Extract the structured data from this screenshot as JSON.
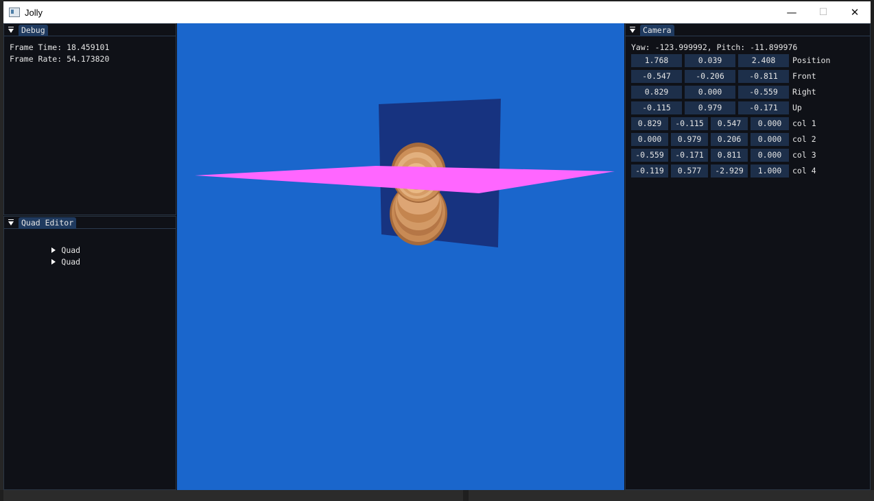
{
  "window": {
    "title": "Jolly",
    "minimize_glyph": "—",
    "maximize_glyph": "☐",
    "close_glyph": "✕"
  },
  "debug": {
    "tab_label": "Debug",
    "frame_time_label": "Frame Time: 18.459101",
    "frame_rate_label": "Frame Rate: 54.173820"
  },
  "quad_editor": {
    "tab_label": "Quad Editor",
    "items": [
      {
        "label": "Quad"
      },
      {
        "label": "Quad"
      }
    ]
  },
  "camera": {
    "tab_label": "Camera",
    "yaw_pitch": "Yaw: -123.999992, Pitch: -11.899976",
    "vectors": [
      {
        "values": [
          "1.768",
          "0.039",
          "2.408"
        ],
        "label": "Position"
      },
      {
        "values": [
          "-0.547",
          "-0.206",
          "-0.811"
        ],
        "label": "Front"
      },
      {
        "values": [
          "0.829",
          "0.000",
          "-0.559"
        ],
        "label": "Right"
      },
      {
        "values": [
          "-0.115",
          "0.979",
          "-0.171"
        ],
        "label": "Up"
      }
    ],
    "matrix": [
      {
        "values": [
          "0.829",
          "-0.115",
          "0.547",
          "0.000"
        ],
        "label": "col 1"
      },
      {
        "values": [
          "0.000",
          "0.979",
          "0.206",
          "0.000"
        ],
        "label": "col 2"
      },
      {
        "values": [
          "-0.559",
          "-0.171",
          "0.811",
          "0.000"
        ],
        "label": "col 3"
      },
      {
        "values": [
          "-0.119",
          "0.577",
          "-2.929",
          "1.000"
        ],
        "label": "col 4"
      }
    ]
  },
  "scene": {
    "background_color": "#1a66cc",
    "dark_quad_color": "#173380",
    "pink_quad_color": "#ff66ff",
    "sprite_color": "#c88a55"
  },
  "icons": {
    "collapse": "collapse-triangle-icon",
    "tree": "tree-arrow-icon",
    "app": "app-window-icon"
  }
}
